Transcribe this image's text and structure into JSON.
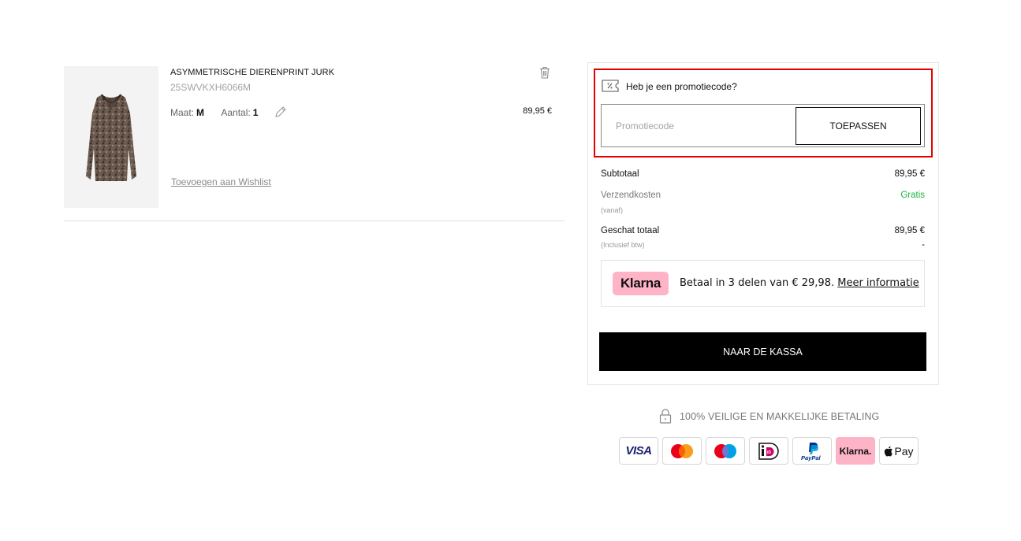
{
  "product": {
    "name": "ASYMMETRISCHE DIERENPRINT JURK",
    "sku": "25SWVKXH6066M",
    "size_label": "Maat:",
    "size_value": "M",
    "quantity_label": "Aantal:",
    "quantity_value": "1",
    "price": "89,95 €",
    "wishlist_label": "Toevoegen aan Wishlist"
  },
  "promo": {
    "title": "Heb je een promotiecode?",
    "placeholder": "Promotiecode",
    "apply_label": "TOEPASSEN"
  },
  "summary": {
    "subtotal_label": "Subtotaal",
    "subtotal_value": "89,95 €",
    "shipping_label": "Verzendkosten",
    "shipping_sub": "(vanaf)",
    "shipping_value": "Gratis",
    "total_label": "Geschat totaal",
    "total_sub": "(Inclusief btw)",
    "total_value": "89,95 €",
    "tax_value": "-"
  },
  "klarna": {
    "badge": "Klarna",
    "text": "Betaal in 3 delen van € 29,98. ",
    "link": "Meer informatie"
  },
  "checkout": {
    "label": "NAAR DE KASSA"
  },
  "secure": {
    "text": "100% VEILIGE EN  MAKKELIJKE BETALING"
  },
  "payment_methods": {
    "visa": "VISA",
    "ideal": "iD",
    "paypal": "PayPal",
    "klarna": "Klarna.",
    "applepay": "Pay"
  },
  "colors": {
    "accent_black": "#000000",
    "highlight_red": "#e60000",
    "klarna_pink": "#ffb3c7",
    "free_green": "#1db341"
  }
}
